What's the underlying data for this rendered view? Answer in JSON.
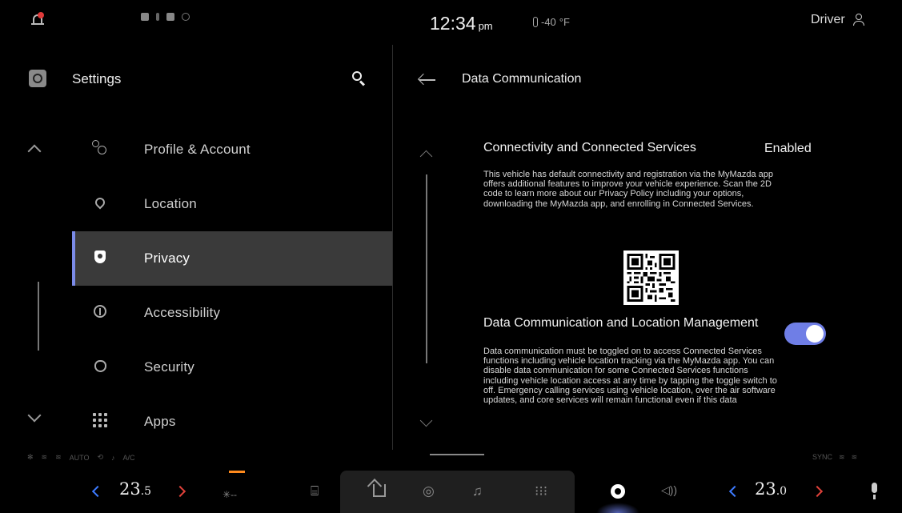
{
  "status": {
    "time": "12:34",
    "ampm": "pm",
    "outside_temp": "-40",
    "temp_unit": "°F",
    "profile": "Driver"
  },
  "settings": {
    "title": "Settings",
    "menu": [
      {
        "label": "Profile & Account",
        "icon": "profile-account-icon"
      },
      {
        "label": "Location",
        "icon": "location-pin-icon"
      },
      {
        "label": "Privacy",
        "icon": "privacy-shield-icon",
        "active": true
      },
      {
        "label": "Accessibility",
        "icon": "accessibility-icon"
      },
      {
        "label": "Security",
        "icon": "security-icon"
      },
      {
        "label": "Apps",
        "icon": "apps-grid-icon"
      }
    ]
  },
  "detail": {
    "title": "Data Communication",
    "connectivity": {
      "title": "Connectivity and Connected Services",
      "status": "Enabled",
      "description": "This vehicle has default connectivity and registration via the MyMazda app offers additional features to improve your vehicle experience. Scan the 2D code to learn more about our Privacy Policy including your options, downloading the MyMazda app, and enrolling in Connected Services."
    },
    "data_comm": {
      "title": "Data Communication and Location Management",
      "toggle_on": true,
      "description": "Data communication must be toggled on to access Connected Services functions including vehicle location tracking via the MyMazda app. You can disable data communication for some Connected Services functions including vehicle location access at any time by tapping the toggle switch to off. Emergency calling services using vehicle location, over the air software updates, and core services will remain functional even if this data"
    }
  },
  "climate": {
    "left_temp_int": "23",
    "left_temp_dec": ".5",
    "right_temp_int": "23",
    "right_temp_dec": ".0",
    "fan": "--",
    "mode_labels": [
      "AUTO",
      "A/C"
    ],
    "sync_label": "SYNC"
  },
  "colors": {
    "accent": "#7b8be8",
    "toggle": "#6f7ee6",
    "temp_down": "#3d7bff",
    "temp_up": "#e0413a",
    "fan_active": "#ff8a1d"
  }
}
